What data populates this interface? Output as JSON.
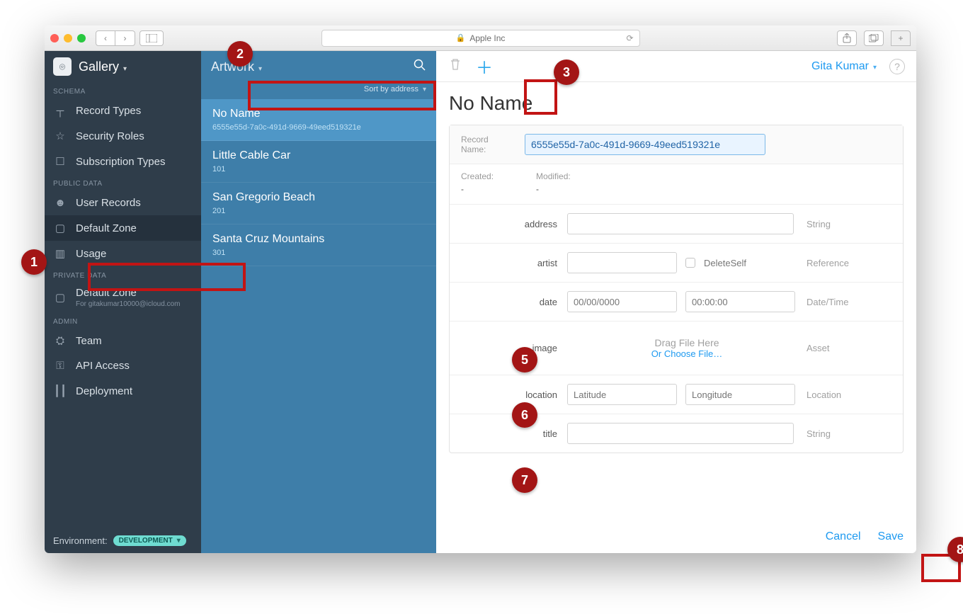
{
  "browser": {
    "address_label": "Apple Inc"
  },
  "sidebar": {
    "app_name": "Gallery",
    "sections": {
      "schema": "SCHEMA",
      "public": "PUBLIC DATA",
      "private": "PRIVATE DATA",
      "admin": "ADMIN"
    },
    "items": {
      "record_types": "Record Types",
      "security_roles": "Security Roles",
      "subscription_types": "Subscription Types",
      "user_records": "User Records",
      "default_zone_pub": "Default Zone",
      "usage": "Usage",
      "default_zone_priv": "Default Zone",
      "default_zone_priv_sub": "For gitakumar10000@icloud.com",
      "team": "Team",
      "api_access": "API Access",
      "deployment": "Deployment"
    },
    "env_label": "Environment:",
    "env_value": "DEVELOPMENT"
  },
  "list": {
    "title": "Artwork",
    "sort_label": "Sort by address",
    "records": [
      {
        "title": "No Name",
        "sub": "6555e55d-7a0c-491d-9669-49eed519321e"
      },
      {
        "title": "Little Cable Car",
        "sub": "101"
      },
      {
        "title": "San Gregorio Beach",
        "sub": "201"
      },
      {
        "title": "Santa Cruz Mountains",
        "sub": "301"
      }
    ]
  },
  "header": {
    "user_name": "Gita Kumar"
  },
  "detail": {
    "title": "No Name",
    "record_name_label": "Record Name:",
    "record_name_value": "6555e55d-7a0c-491d-9669-49eed519321e",
    "created_label": "Created:",
    "created_value": "-",
    "modified_label": "Modified:",
    "modified_value": "-",
    "fields": {
      "address": {
        "label": "address",
        "type": "String"
      },
      "artist": {
        "label": "artist",
        "type": "Reference",
        "option": "DeleteSelf"
      },
      "date": {
        "label": "date",
        "type": "Date/Time",
        "date_ph": "00/00/0000",
        "time_ph": "00:00:00"
      },
      "image": {
        "label": "image",
        "type": "Asset",
        "drag": "Drag File Here",
        "choose": "Or Choose File…"
      },
      "location": {
        "label": "location",
        "type": "Location",
        "lat_ph": "Latitude",
        "lon_ph": "Longitude"
      },
      "title": {
        "label": "title",
        "type": "String"
      }
    },
    "cancel": "Cancel",
    "save": "Save"
  },
  "callouts": [
    "1",
    "2",
    "3",
    "5",
    "6",
    "7",
    "8"
  ]
}
